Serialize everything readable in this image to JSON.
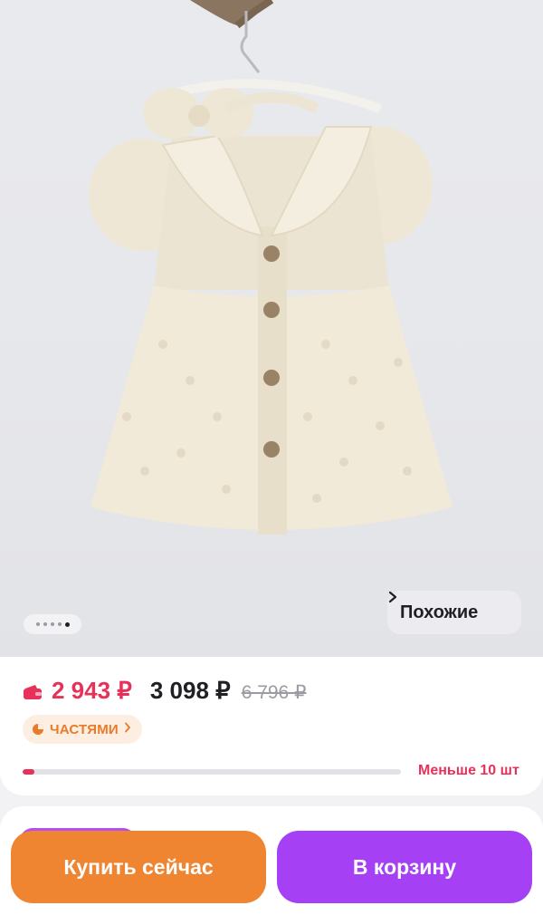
{
  "gallery": {
    "image_alt": "product-photo-dress",
    "dots_count": 5,
    "active_dot": 4,
    "similar_label": "Похожие"
  },
  "price": {
    "sale_price": "2 943 ₽",
    "regular_price": "3 098 ₽",
    "old_price": "6 796 ₽",
    "installments_label": "ЧАСТЯМИ",
    "stock_label": "Меньше 10 шт",
    "stock_fraction": 0.03
  },
  "actions": {
    "buy_now_label": "Купить сейчас",
    "add_to_cart_label": "В корзину"
  },
  "colors": {
    "accent_pink": "#e8315a",
    "accent_orange": "#ef8431",
    "accent_purple": "#a540f5",
    "installments_bg": "#fdeee2"
  },
  "icons": [
    "wallet-icon",
    "pie-chart-icon",
    "chevron-right-icon"
  ]
}
